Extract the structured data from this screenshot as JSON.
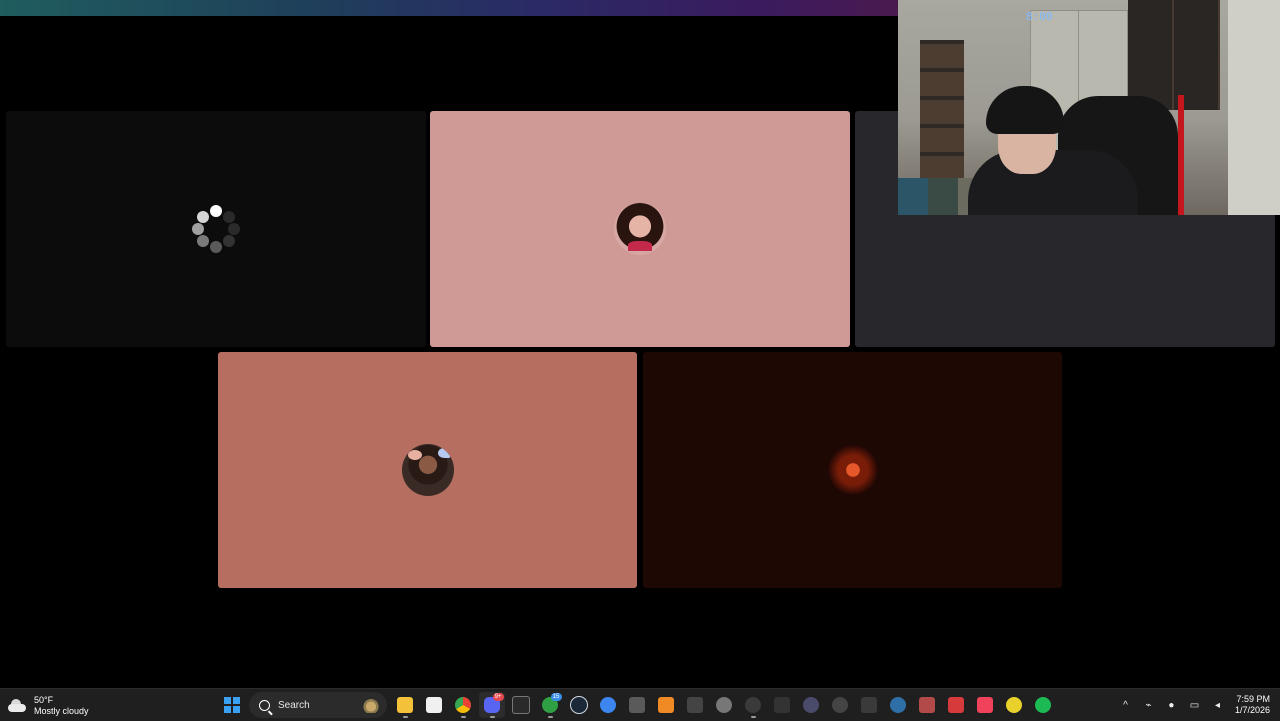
{
  "call": {
    "tiles": [
      {
        "id": "t1",
        "state": "loading",
        "background": "#0c0c0c"
      },
      {
        "id": "t2",
        "avatar": "woman-avatar",
        "background": "#cf9995"
      },
      {
        "id": "t3",
        "avatar": "orange-jacket-avatar",
        "background": "#28272c"
      },
      {
        "id": "t4",
        "avatar": "man-butterfly-avatar",
        "background": "#b56e60"
      },
      {
        "id": "t5",
        "avatar": "fire-avatar",
        "background": "#1d0804"
      }
    ],
    "webcam": {
      "clock_text": "8:00"
    }
  },
  "taskbar": {
    "weather": {
      "temp": "50°F",
      "condition": "Mostly cloudy"
    },
    "search": {
      "placeholder": "Search"
    },
    "apps": [
      {
        "name": "start-button",
        "icon": "windows-icon"
      },
      {
        "name": "file-explorer",
        "icon": "folder-icon",
        "color": "#f3c13a"
      },
      {
        "name": "microsoft-store",
        "icon": "store-icon",
        "color": "#f0f0f0"
      },
      {
        "name": "chrome",
        "icon": "chrome-icon",
        "color": "#34a853"
      },
      {
        "name": "discord",
        "icon": "discord-icon",
        "color": "#5865f2",
        "badge": "9+"
      },
      {
        "name": "epic-games",
        "icon": "epic-icon",
        "color": "#2a2a2a"
      },
      {
        "name": "xbox",
        "icon": "xbox-icon",
        "color": "#2ea043",
        "badge": "15"
      },
      {
        "name": "steam",
        "icon": "steam-icon",
        "color": "#1b2838"
      },
      {
        "name": "browser",
        "icon": "browser-icon",
        "color": "#3d86f0"
      },
      {
        "name": "minecraft",
        "icon": "minecraft-icon",
        "color": "#5a5a5a"
      },
      {
        "name": "app-orange",
        "icon": "triangle-icon",
        "color": "#f08a24"
      },
      {
        "name": "pen-app",
        "icon": "pen-icon",
        "color": "#444444"
      },
      {
        "name": "settings",
        "icon": "gear-icon",
        "color": "#777777"
      },
      {
        "name": "obs",
        "icon": "record-icon",
        "color": "#3a3a3a"
      },
      {
        "name": "capcut",
        "icon": "capcut-icon",
        "color": "#333333"
      },
      {
        "name": "app-a",
        "icon": "media-icon",
        "color": "#4a4a6a"
      },
      {
        "name": "app-4k",
        "icon": "4k-icon",
        "color": "#444444"
      },
      {
        "name": "app-b",
        "icon": "tool-icon",
        "color": "#3a3a3a"
      },
      {
        "name": "app-c",
        "icon": "refresh-icon",
        "color": "#2f6fa8"
      },
      {
        "name": "app-d",
        "icon": "shield-icon",
        "color": "#b34a4a"
      },
      {
        "name": "app-e",
        "icon": "play-icon",
        "color": "#d63a3a"
      },
      {
        "name": "music",
        "icon": "music-icon",
        "color": "#f0425a"
      },
      {
        "name": "app-f",
        "icon": "face-icon",
        "color": "#e8d12a"
      },
      {
        "name": "spotify",
        "icon": "spotify-icon",
        "color": "#1db954"
      }
    ],
    "tray": {
      "time": "7:59 PM",
      "date": "1/7/2026"
    }
  }
}
